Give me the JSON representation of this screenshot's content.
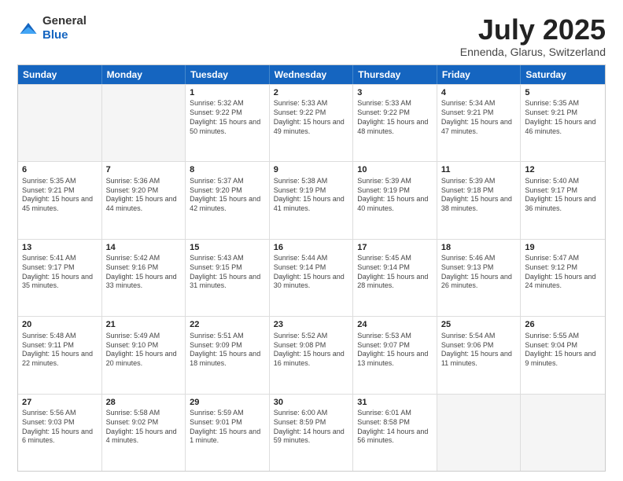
{
  "header": {
    "logo_general": "General",
    "logo_blue": "Blue",
    "month_title": "July 2025",
    "location": "Ennenda, Glarus, Switzerland"
  },
  "days_of_week": [
    "Sunday",
    "Monday",
    "Tuesday",
    "Wednesday",
    "Thursday",
    "Friday",
    "Saturday"
  ],
  "weeks": [
    [
      {
        "day": "",
        "sunrise": "",
        "sunset": "",
        "daylight": "",
        "empty": true
      },
      {
        "day": "",
        "sunrise": "",
        "sunset": "",
        "daylight": "",
        "empty": true
      },
      {
        "day": "1",
        "sunrise": "Sunrise: 5:32 AM",
        "sunset": "Sunset: 9:22 PM",
        "daylight": "Daylight: 15 hours and 50 minutes.",
        "empty": false
      },
      {
        "day": "2",
        "sunrise": "Sunrise: 5:33 AM",
        "sunset": "Sunset: 9:22 PM",
        "daylight": "Daylight: 15 hours and 49 minutes.",
        "empty": false
      },
      {
        "day": "3",
        "sunrise": "Sunrise: 5:33 AM",
        "sunset": "Sunset: 9:22 PM",
        "daylight": "Daylight: 15 hours and 48 minutes.",
        "empty": false
      },
      {
        "day": "4",
        "sunrise": "Sunrise: 5:34 AM",
        "sunset": "Sunset: 9:21 PM",
        "daylight": "Daylight: 15 hours and 47 minutes.",
        "empty": false
      },
      {
        "day": "5",
        "sunrise": "Sunrise: 5:35 AM",
        "sunset": "Sunset: 9:21 PM",
        "daylight": "Daylight: 15 hours and 46 minutes.",
        "empty": false
      }
    ],
    [
      {
        "day": "6",
        "sunrise": "Sunrise: 5:35 AM",
        "sunset": "Sunset: 9:21 PM",
        "daylight": "Daylight: 15 hours and 45 minutes.",
        "empty": false
      },
      {
        "day": "7",
        "sunrise": "Sunrise: 5:36 AM",
        "sunset": "Sunset: 9:20 PM",
        "daylight": "Daylight: 15 hours and 44 minutes.",
        "empty": false
      },
      {
        "day": "8",
        "sunrise": "Sunrise: 5:37 AM",
        "sunset": "Sunset: 9:20 PM",
        "daylight": "Daylight: 15 hours and 42 minutes.",
        "empty": false
      },
      {
        "day": "9",
        "sunrise": "Sunrise: 5:38 AM",
        "sunset": "Sunset: 9:19 PM",
        "daylight": "Daylight: 15 hours and 41 minutes.",
        "empty": false
      },
      {
        "day": "10",
        "sunrise": "Sunrise: 5:39 AM",
        "sunset": "Sunset: 9:19 PM",
        "daylight": "Daylight: 15 hours and 40 minutes.",
        "empty": false
      },
      {
        "day": "11",
        "sunrise": "Sunrise: 5:39 AM",
        "sunset": "Sunset: 9:18 PM",
        "daylight": "Daylight: 15 hours and 38 minutes.",
        "empty": false
      },
      {
        "day": "12",
        "sunrise": "Sunrise: 5:40 AM",
        "sunset": "Sunset: 9:17 PM",
        "daylight": "Daylight: 15 hours and 36 minutes.",
        "empty": false
      }
    ],
    [
      {
        "day": "13",
        "sunrise": "Sunrise: 5:41 AM",
        "sunset": "Sunset: 9:17 PM",
        "daylight": "Daylight: 15 hours and 35 minutes.",
        "empty": false
      },
      {
        "day": "14",
        "sunrise": "Sunrise: 5:42 AM",
        "sunset": "Sunset: 9:16 PM",
        "daylight": "Daylight: 15 hours and 33 minutes.",
        "empty": false
      },
      {
        "day": "15",
        "sunrise": "Sunrise: 5:43 AM",
        "sunset": "Sunset: 9:15 PM",
        "daylight": "Daylight: 15 hours and 31 minutes.",
        "empty": false
      },
      {
        "day": "16",
        "sunrise": "Sunrise: 5:44 AM",
        "sunset": "Sunset: 9:14 PM",
        "daylight": "Daylight: 15 hours and 30 minutes.",
        "empty": false
      },
      {
        "day": "17",
        "sunrise": "Sunrise: 5:45 AM",
        "sunset": "Sunset: 9:14 PM",
        "daylight": "Daylight: 15 hours and 28 minutes.",
        "empty": false
      },
      {
        "day": "18",
        "sunrise": "Sunrise: 5:46 AM",
        "sunset": "Sunset: 9:13 PM",
        "daylight": "Daylight: 15 hours and 26 minutes.",
        "empty": false
      },
      {
        "day": "19",
        "sunrise": "Sunrise: 5:47 AM",
        "sunset": "Sunset: 9:12 PM",
        "daylight": "Daylight: 15 hours and 24 minutes.",
        "empty": false
      }
    ],
    [
      {
        "day": "20",
        "sunrise": "Sunrise: 5:48 AM",
        "sunset": "Sunset: 9:11 PM",
        "daylight": "Daylight: 15 hours and 22 minutes.",
        "empty": false
      },
      {
        "day": "21",
        "sunrise": "Sunrise: 5:49 AM",
        "sunset": "Sunset: 9:10 PM",
        "daylight": "Daylight: 15 hours and 20 minutes.",
        "empty": false
      },
      {
        "day": "22",
        "sunrise": "Sunrise: 5:51 AM",
        "sunset": "Sunset: 9:09 PM",
        "daylight": "Daylight: 15 hours and 18 minutes.",
        "empty": false
      },
      {
        "day": "23",
        "sunrise": "Sunrise: 5:52 AM",
        "sunset": "Sunset: 9:08 PM",
        "daylight": "Daylight: 15 hours and 16 minutes.",
        "empty": false
      },
      {
        "day": "24",
        "sunrise": "Sunrise: 5:53 AM",
        "sunset": "Sunset: 9:07 PM",
        "daylight": "Daylight: 15 hours and 13 minutes.",
        "empty": false
      },
      {
        "day": "25",
        "sunrise": "Sunrise: 5:54 AM",
        "sunset": "Sunset: 9:06 PM",
        "daylight": "Daylight: 15 hours and 11 minutes.",
        "empty": false
      },
      {
        "day": "26",
        "sunrise": "Sunrise: 5:55 AM",
        "sunset": "Sunset: 9:04 PM",
        "daylight": "Daylight: 15 hours and 9 minutes.",
        "empty": false
      }
    ],
    [
      {
        "day": "27",
        "sunrise": "Sunrise: 5:56 AM",
        "sunset": "Sunset: 9:03 PM",
        "daylight": "Daylight: 15 hours and 6 minutes.",
        "empty": false
      },
      {
        "day": "28",
        "sunrise": "Sunrise: 5:58 AM",
        "sunset": "Sunset: 9:02 PM",
        "daylight": "Daylight: 15 hours and 4 minutes.",
        "empty": false
      },
      {
        "day": "29",
        "sunrise": "Sunrise: 5:59 AM",
        "sunset": "Sunset: 9:01 PM",
        "daylight": "Daylight: 15 hours and 1 minute.",
        "empty": false
      },
      {
        "day": "30",
        "sunrise": "Sunrise: 6:00 AM",
        "sunset": "Sunset: 8:59 PM",
        "daylight": "Daylight: 14 hours and 59 minutes.",
        "empty": false
      },
      {
        "day": "31",
        "sunrise": "Sunrise: 6:01 AM",
        "sunset": "Sunset: 8:58 PM",
        "daylight": "Daylight: 14 hours and 56 minutes.",
        "empty": false
      },
      {
        "day": "",
        "sunrise": "",
        "sunset": "",
        "daylight": "",
        "empty": true
      },
      {
        "day": "",
        "sunrise": "",
        "sunset": "",
        "daylight": "",
        "empty": true
      }
    ]
  ]
}
